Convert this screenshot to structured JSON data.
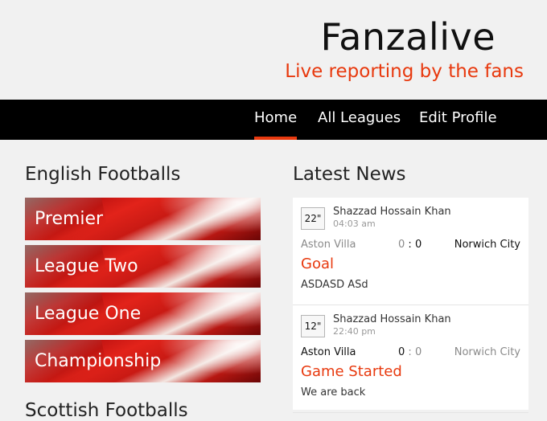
{
  "brand": {
    "title": "Fanzalive",
    "tagline": "Live reporting by the fans"
  },
  "nav": {
    "items": [
      {
        "label": "Home",
        "active": true
      },
      {
        "label": "All Leagues",
        "active": false
      },
      {
        "label": "Edit Profile",
        "active": false
      }
    ]
  },
  "english": {
    "heading": "English Footballs",
    "leagues": [
      "Premier",
      "League Two",
      "League One",
      "Championship"
    ]
  },
  "scottish": {
    "heading": "Scottish Footballs"
  },
  "news": {
    "heading": "Latest News",
    "items": [
      {
        "minute": "22\"",
        "author": "Shazzad Hossain Khan",
        "time": "04:03 am",
        "home_team": "Aston Villa",
        "home_score": "0",
        "separator": ":",
        "away_score": "0",
        "away_team": "Norwich City",
        "highlighted_side": "away",
        "event": "Goal",
        "note": "ASDASD ASd"
      },
      {
        "minute": "12\"",
        "author": "Shazzad Hossain Khan",
        "time": "22:40 pm",
        "home_team": "Aston Villa",
        "home_score": "0",
        "separator": ":",
        "away_score": "0",
        "away_team": "Norwich City",
        "highlighted_side": "home",
        "event": "Game Started",
        "note": "We are back"
      }
    ]
  },
  "colors": {
    "accent": "#e8390e",
    "nav_background": "#000000",
    "page_background": "#f1f1f1"
  }
}
